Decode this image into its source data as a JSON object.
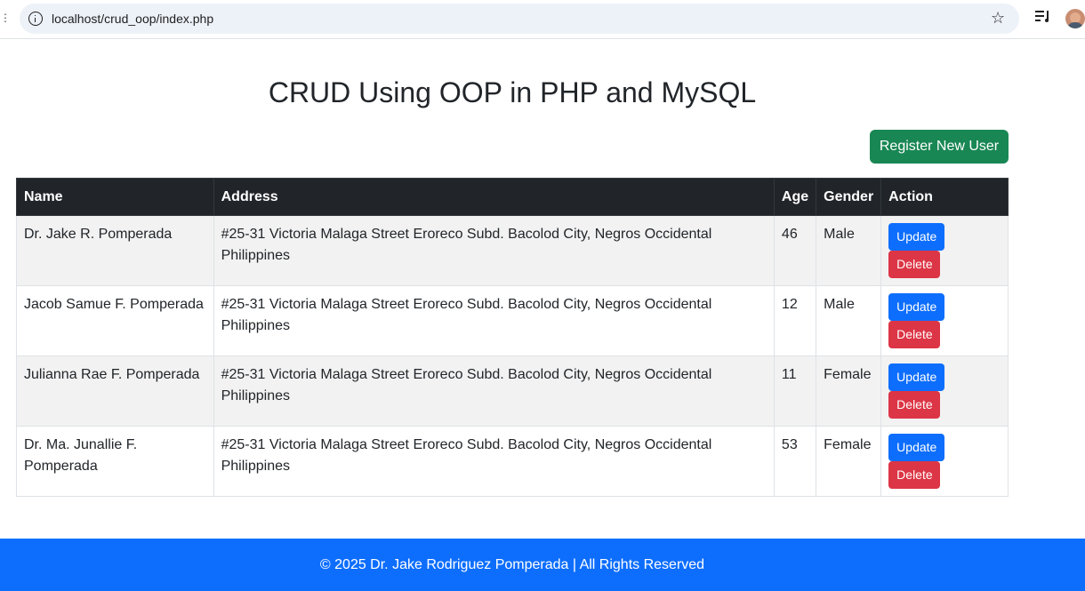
{
  "browser": {
    "url": "localhost/crud_oop/index.php"
  },
  "page": {
    "title": "CRUD Using OOP in PHP and MySQL",
    "register_label": "Register New User"
  },
  "table": {
    "headers": {
      "name": "Name",
      "address": "Address",
      "age": "Age",
      "gender": "Gender",
      "action": "Action"
    },
    "rows": [
      {
        "name": "Dr. Jake R. Pomperada",
        "address": "#25-31 Victoria Malaga Street Eroreco Subd. Bacolod City, Negros Occidental Philippines",
        "age": "46",
        "gender": "Male",
        "update_label": "Update",
        "delete_label": "Delete"
      },
      {
        "name": "Jacob Samue F. Pomperada",
        "address": "#25-31 Victoria Malaga Street Eroreco Subd. Bacolod City, Negros Occidental Philippines",
        "age": "12",
        "gender": "Male",
        "update_label": "Update",
        "delete_label": "Delete"
      },
      {
        "name": "Julianna Rae F. Pomperada",
        "address": "#25-31 Victoria Malaga Street Eroreco Subd. Bacolod City, Negros Occidental Philippines",
        "age": "11",
        "gender": "Female",
        "update_label": "Update",
        "delete_label": "Delete"
      },
      {
        "name": "Dr. Ma. Junallie F. Pomperada",
        "address": "#25-31 Victoria Malaga Street Eroreco Subd. Bacolod City, Negros Occidental Philippines",
        "age": "53",
        "gender": "Female",
        "update_label": "Update",
        "delete_label": "Delete"
      }
    ]
  },
  "footer": {
    "text": "© 2025 Dr. Jake Rodriguez Pomperada | All Rights Reserved"
  },
  "colors": {
    "register_button": "#198754",
    "update_button": "#0d6efd",
    "delete_button": "#dc3545",
    "table_header": "#212529",
    "footer": "#0d6efd"
  },
  "icons": {
    "site_info": "info-icon",
    "bookmark": "star-icon",
    "media": "media-control-icon",
    "profile": "avatar"
  }
}
